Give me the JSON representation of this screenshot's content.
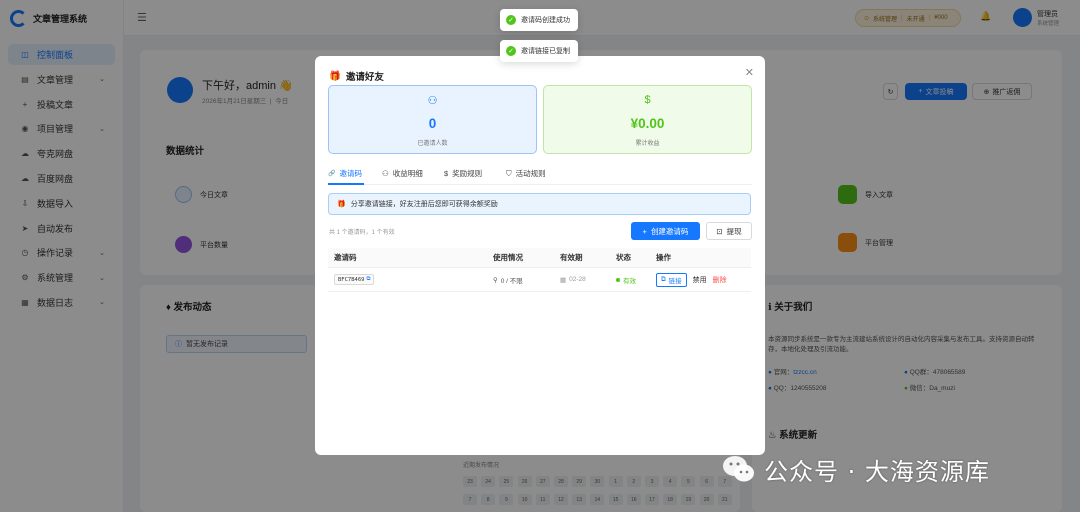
{
  "app": {
    "name": "文章管理系统"
  },
  "sidebar": {
    "items": [
      {
        "label": "控制面板",
        "icon": "dashboard-icon",
        "glyph": "◫",
        "active": true,
        "caret": false
      },
      {
        "label": "文章管理",
        "icon": "doc-icon",
        "glyph": "▤",
        "active": false,
        "caret": true
      },
      {
        "label": "投稿文章",
        "icon": "plus-icon",
        "glyph": "+",
        "active": false,
        "caret": false
      },
      {
        "label": "项目管理",
        "icon": "eye-icon",
        "glyph": "◉",
        "active": false,
        "caret": true
      },
      {
        "label": "夸克网盘",
        "icon": "cloud-icon",
        "glyph": "☁",
        "active": false,
        "caret": false
      },
      {
        "label": "百度网盘",
        "icon": "cloud-icon",
        "glyph": "☁",
        "active": false,
        "caret": false
      },
      {
        "label": "数据导入",
        "icon": "import-icon",
        "glyph": "⇩",
        "active": false,
        "caret": false
      },
      {
        "label": "自动发布",
        "icon": "send-icon",
        "glyph": "➤",
        "active": false,
        "caret": false
      },
      {
        "label": "操作记录",
        "icon": "history-icon",
        "glyph": "◷",
        "active": false,
        "caret": true
      },
      {
        "label": "系统管理",
        "icon": "gear-icon",
        "glyph": "⚙",
        "active": false,
        "caret": true
      },
      {
        "label": "数据日志",
        "icon": "chart-icon",
        "glyph": "▦",
        "active": false,
        "caret": true
      }
    ]
  },
  "topbar": {
    "system_pill": "系统管理",
    "system_pill_mid": "未开通",
    "system_pill_end": "¥000",
    "user_role": "管理员",
    "user_sub": "系统管理"
  },
  "page": {
    "greeting": "下午好，admin 👋",
    "date": "2026年1月21日星期三",
    "date_suffix": "今日",
    "new_post_button": "文章投稿",
    "promote_button": "推广返佣",
    "stats_heading": "数据统计",
    "chips": {
      "today_articles": "今日文章",
      "platform_count": "平台数量",
      "import_articles": "导入文章",
      "platform_manage": "平台管理"
    },
    "publish_heading": "发布动态",
    "empty_publish": "暂无发布记录",
    "about_heading": "关于我们",
    "about_text": "本资源同步系统是一款专为主流建站系统设计的自动化内容采集与发布工具。支持资源自动转存，本地化处理及引流功能。",
    "contact_site_label": "官网：",
    "contact_site_value": "tzzcc.cn",
    "contact_qqgroup": "QQ群：478065589",
    "contact_qq": "QQ：1240555208",
    "contact_wechat": "微信：Da_muzi",
    "update_heading": "系统更新",
    "calendar_caption": "近期发布情况",
    "calendar_row1": [
      "23",
      "24",
      "25",
      "26",
      "27",
      "28",
      "29",
      "30",
      "1",
      "2",
      "3",
      "4",
      "5",
      "6",
      "7"
    ],
    "calendar_row2": [
      "7",
      "8",
      "9",
      "10",
      "11",
      "12",
      "13",
      "14",
      "15",
      "16",
      "17",
      "18",
      "19",
      "20",
      "21"
    ]
  },
  "toasts": [
    {
      "text": "邀请码创建成功"
    },
    {
      "text": "邀请链接已复制"
    }
  ],
  "modal": {
    "title": "邀请好友",
    "stats": [
      {
        "value": "0",
        "label": "已邀请人数",
        "icon": "users-icon"
      },
      {
        "value": "¥0.00",
        "label": "累计收益",
        "icon": "dollar-icon"
      }
    ],
    "tabs": [
      {
        "label": "邀请码",
        "icon": "link-icon",
        "glyph": "🔗"
      },
      {
        "label": "收益明细",
        "icon": "users-icon",
        "glyph": "⚇"
      },
      {
        "label": "奖励规则",
        "icon": "dollar-icon",
        "glyph": "$"
      },
      {
        "label": "活动规则",
        "icon": "shield-icon",
        "glyph": "⛉"
      }
    ],
    "info": "分享邀请链接，好友注册后您即可获得余额奖励",
    "count_text": "共 1 个邀请码，1 个有效",
    "create_button": "创建邀请码",
    "withdraw_button": "提现",
    "table": {
      "headers": [
        "邀请码",
        "使用情况",
        "有效期",
        "状态",
        "操作"
      ],
      "rows": [
        {
          "code": "BFC7B469",
          "usage": "0 / 不限",
          "expiry": "02-28",
          "status": "有效",
          "op_link": "链接",
          "op_disable": "禁用",
          "op_delete": "删除"
        }
      ]
    }
  },
  "watermark": "公众号 · 大海资源库",
  "colors": {
    "primary": "#1677ff",
    "success": "#52c41a",
    "danger": "#ff4d4f",
    "warn": "#faad14"
  }
}
